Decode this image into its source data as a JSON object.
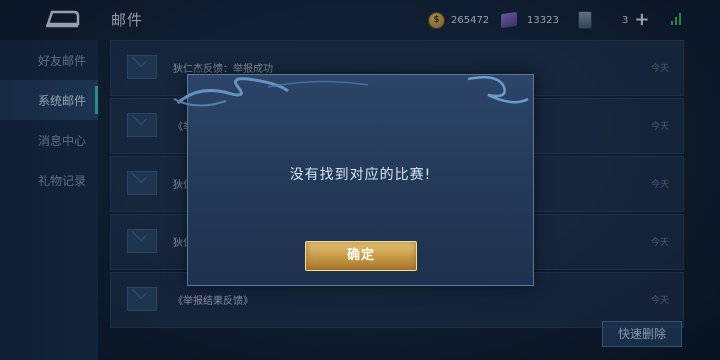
{
  "header": {
    "title": "邮件",
    "gold": "265472",
    "gems": "13323",
    "cards": "3",
    "back_icon": "back-arrow-icon",
    "gold_icon": "gold-coin-icon",
    "gem_icon": "gem-icon",
    "card_icon": "card-icon",
    "plus_icon": "plus-icon"
  },
  "sidebar": {
    "items": [
      {
        "label": "好友邮件",
        "active": false
      },
      {
        "label": "系统邮件",
        "active": true
      },
      {
        "label": "消息中心",
        "active": false
      },
      {
        "label": "礼物记录",
        "active": false
      }
    ]
  },
  "mails": [
    {
      "subject": "狄仁杰反馈：举报成功",
      "time": "今天"
    },
    {
      "subject": "《举",
      "time": "今天"
    },
    {
      "subject": "狄仁",
      "time": "今天"
    },
    {
      "subject": "狄仁",
      "time": "今天"
    },
    {
      "subject": "《举报结果反馈》",
      "time": "今天"
    }
  ],
  "footer": {
    "quick_delete_label": "快速删除"
  },
  "dialog": {
    "message": "没有找到对应的比赛!",
    "confirm_label": "确定"
  },
  "colors": {
    "accent": "#3fd2c4",
    "button_gold": "#c49645",
    "panel": "#243a59"
  }
}
